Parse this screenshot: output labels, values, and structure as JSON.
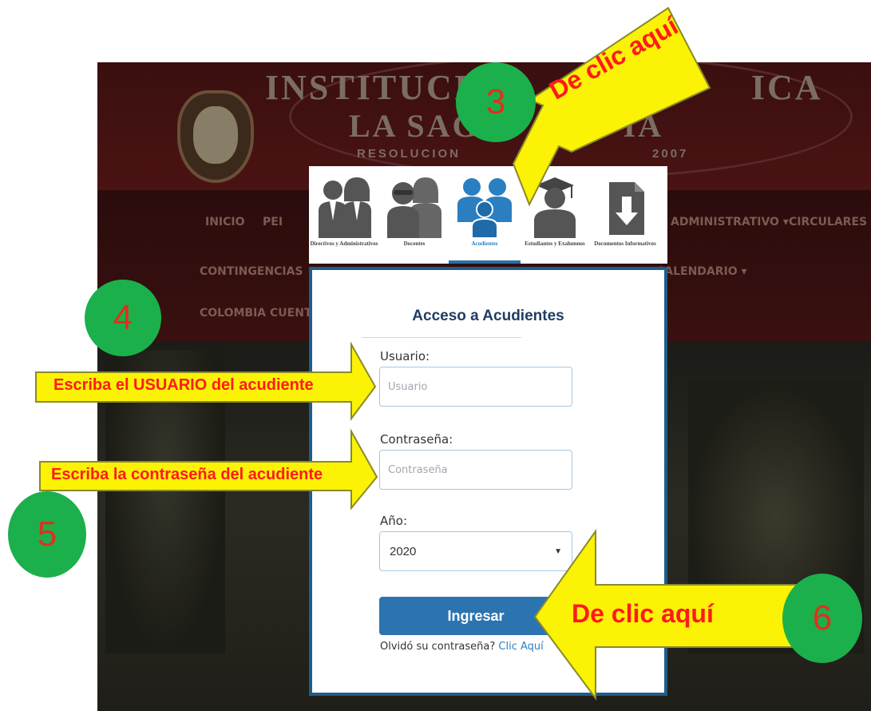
{
  "site": {
    "institution_line1": "INSTITUCIÓN",
    "institution_line1_end": "ICA",
    "institution_line2": "LA SAG",
    "institution_line2_end": "IA",
    "resolution": "RESOLUCION",
    "resolution_year": "2007",
    "nav_items": [
      "INICIO",
      "PEI",
      "ADMINISTRATIVO ▾",
      "CIRCULARES",
      "CONTINGENCIAS",
      "CALENDARIO ▾",
      "COLOMBIA CUENTA"
    ]
  },
  "tabs": [
    {
      "label": "Directivos y Administrativos",
      "icon": "admin-staff-icon",
      "active": false
    },
    {
      "label": "Docentes",
      "icon": "teachers-icon",
      "active": false
    },
    {
      "label": "Acudientes",
      "icon": "guardians-icon",
      "active": true
    },
    {
      "label": "Estudiantes y Exalumnos",
      "icon": "graduate-icon",
      "active": false
    },
    {
      "label": "Documentos Informativos",
      "icon": "document-download-icon",
      "active": false
    }
  ],
  "login": {
    "title": "Acceso a Acudientes",
    "username_label": "Usuario:",
    "username_placeholder": "Usuario",
    "password_label": "Contraseña:",
    "password_placeholder": "Contraseña",
    "year_label": "Año:",
    "year_value": "2020",
    "submit_label": "Ingresar",
    "forgot_text": "Olvidó su contraseña?",
    "forgot_link": "Clic Aquí"
  },
  "annotations": {
    "step3_number": "3",
    "step3_text": "De clic aquí",
    "step4_number": "4",
    "step4_text": "Escriba el USUARIO del acudiente",
    "step5_number": "5",
    "step5_text": "Escriba la contraseña del acudiente",
    "step6_number": "6",
    "step6_text": "De clic aquí"
  },
  "colors": {
    "accent_blue": "#2c74b0",
    "panel_border": "#1f5d8c",
    "callout_yellow": "#fbf205",
    "callout_text_red": "#ff1a1a",
    "step_circle_green": "#1bb04c"
  }
}
